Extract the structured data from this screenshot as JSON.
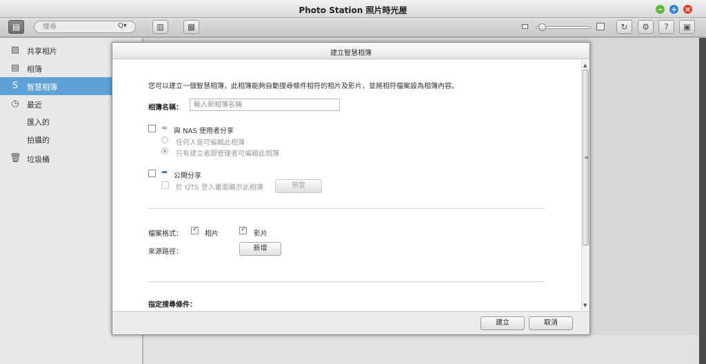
{
  "window": {
    "title": "Photo Station 照片時光屋"
  },
  "toolbar": {
    "search_placeholder": "搜尋",
    "sidebar_toggle_icon": "sidebar-icon",
    "list_view_icon": "list-view-icon",
    "grid_view_icon": "grid-view-icon",
    "refresh_icon": "refresh-icon",
    "settings_icon": "gear-icon",
    "help_label": "?",
    "panel_icon": "panel-icon"
  },
  "sidebar": {
    "items": [
      {
        "label": "共享相片",
        "icon": "photo-icon"
      },
      {
        "label": "相簿",
        "icon": "album-icon"
      },
      {
        "label": "智慧相簿",
        "icon": "smart-album-icon",
        "active": true
      },
      {
        "label": "最近",
        "icon": "clock-icon"
      },
      {
        "label": "匯入的",
        "icon": ""
      },
      {
        "label": "拍攝的",
        "icon": ""
      },
      {
        "label": "垃圾桶",
        "icon": "trash-icon"
      }
    ]
  },
  "dialog": {
    "title": "建立智慧相簿",
    "description": "您可以建立一個智慧相簿，此相簿能夠自動搜尋條件相符的相片及影片，並將相符檔案設為相簿內容。",
    "album_name_label": "相簿名稱：",
    "album_name_placeholder": "輸入新相簿名稱",
    "share_nas": {
      "label": "與 NAS 使用者分享",
      "checked": false,
      "options": [
        {
          "label": "任何人皆可編輯此相簿",
          "selected": false
        },
        {
          "label": "只有建立者跟管理者可編輯此相簿",
          "selected": true
        }
      ]
    },
    "public_share": {
      "label": "公開分享",
      "checked": false,
      "show_on_login_label": "於 QTS 登入畫面顯示此相簿",
      "preview_button": "預覽"
    },
    "file_format": {
      "label": "檔案格式：",
      "photo_label": "相片",
      "photo_checked": true,
      "video_label": "影片",
      "video_checked": true
    },
    "source_path": {
      "label": "來源路徑：",
      "add_button": "新增"
    },
    "search_conditions_label": "指定搜尋條件：",
    "ok_button": "建立",
    "cancel_button": "取消"
  }
}
